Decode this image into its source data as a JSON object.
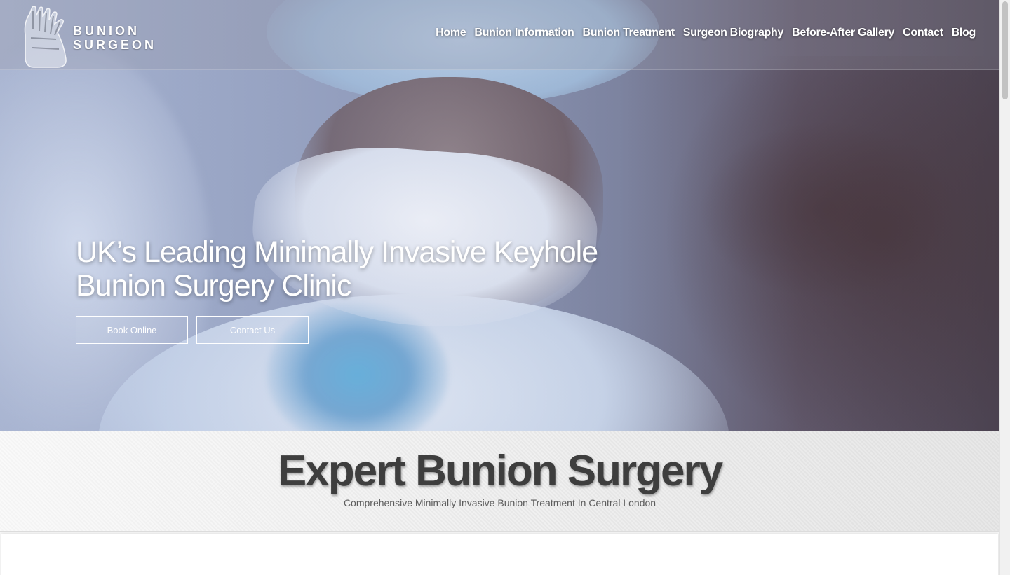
{
  "logo": {
    "line1": "BUNION",
    "line2": "SURGEON",
    "icon": "foot-bones-icon"
  },
  "nav": {
    "items": [
      {
        "label": "Home"
      },
      {
        "label": "Bunion Information"
      },
      {
        "label": "Bunion Treatment"
      },
      {
        "label": "Surgeon Biography"
      },
      {
        "label": "Before-After Gallery"
      },
      {
        "label": "Contact"
      },
      {
        "label": "Blog"
      }
    ]
  },
  "hero": {
    "title_line1": "UK’s Leading Minimally Invasive Keyhole",
    "title_line2": "Bunion Surgery Clinic",
    "book_button": "Book Online",
    "contact_button": "Contact Us"
  },
  "section": {
    "title": "Expert Bunion Surgery",
    "subtitle": "Comprehensive Minimally Invasive Bunion Treatment In Central London"
  },
  "colors": {
    "header_text": "#ffffff",
    "section_title": "#3e3e3e",
    "section_background": "#ededed"
  }
}
